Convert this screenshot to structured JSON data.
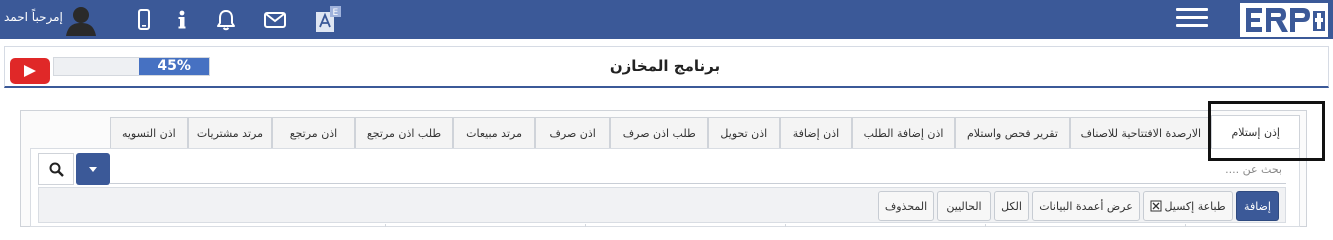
{
  "header": {
    "user_name": "إمرحباً احمد",
    "icons": [
      "user-avatar",
      "mobile-icon",
      "info-icon",
      "bell-icon",
      "envelope-icon",
      "translate-icon",
      "menu-icon"
    ],
    "accent_color": "#3b5998"
  },
  "page": {
    "title": "برنامج المخازن",
    "progress_label": "45%",
    "progress_fraction": 0.45
  },
  "tabs": [
    "إذن إستلام",
    "الارصدة الافتتاحية للاصناف",
    "تقرير فحص واستلام",
    "اذن إضافة الطلب",
    "اذن إضافة",
    "اذن تحويل",
    "طلب اذن صرف",
    "اذن صرف",
    "مرتد مبيعات",
    "طلب اذن مرتجع",
    "اذن مرتجع",
    "مرتد مشتريات",
    "اذن التسويه"
  ],
  "search": {
    "placeholder": "بحث عن ...."
  },
  "toolbar": {
    "add": "إضافة",
    "print_excel": "طباعة إكسيل",
    "show_columns": "عرض أعمدة البيانات",
    "all": "الكل",
    "current": "الحاليين",
    "deleted": "المحذوف"
  }
}
